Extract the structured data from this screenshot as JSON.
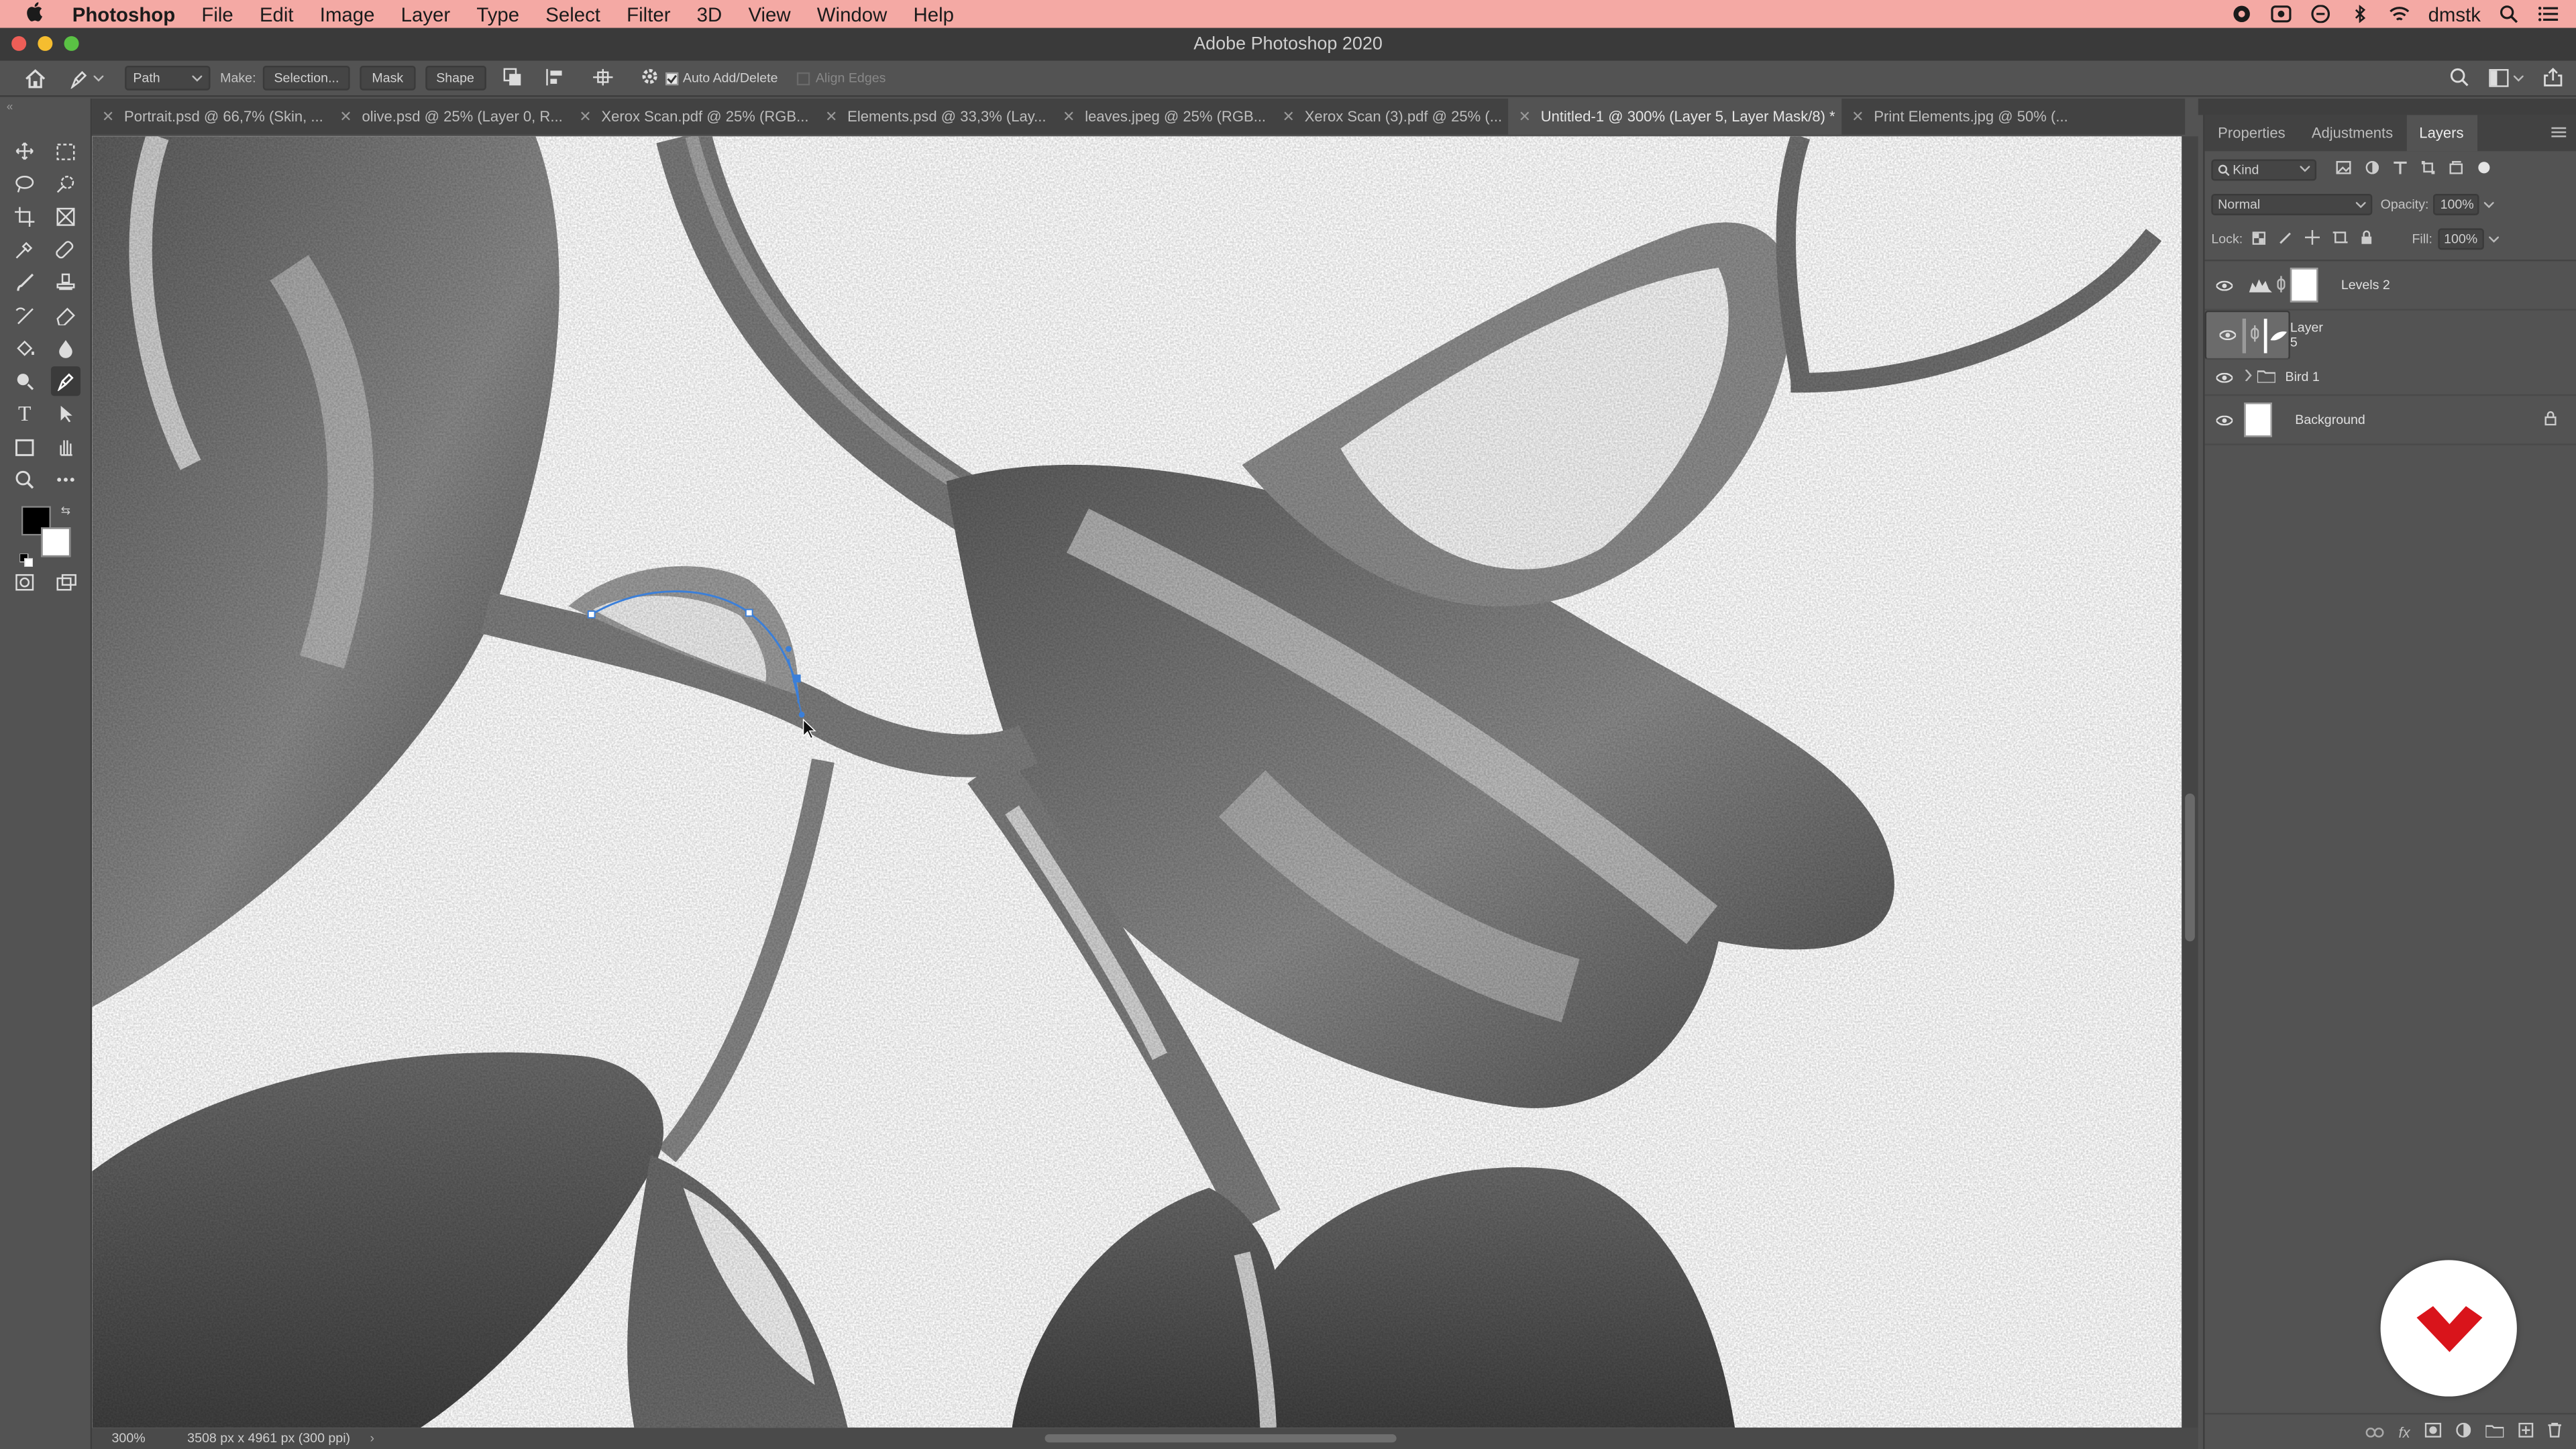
{
  "menubar": {
    "items": [
      "Photoshop",
      "File",
      "Edit",
      "Image",
      "Layer",
      "Type",
      "Select",
      "Filter",
      "3D",
      "View",
      "Window",
      "Help"
    ],
    "user": "dmstk"
  },
  "window": {
    "title": "Adobe Photoshop 2020"
  },
  "options": {
    "mode": "Path",
    "make_label": "Make:",
    "selection_button": "Selection...",
    "mask_button": "Mask",
    "shape_button": "Shape",
    "auto_add_delete": "Auto Add/Delete",
    "align_edges": "Align Edges"
  },
  "tabs": [
    {
      "label": "Portrait.psd @ 66,7% (Skin, ..."
    },
    {
      "label": "olive.psd @ 25% (Layer 0, R..."
    },
    {
      "label": "Xerox Scan.pdf @ 25% (RGB..."
    },
    {
      "label": "Elements.psd @ 33,3% (Lay..."
    },
    {
      "label": "leaves.jpeg @ 25% (RGB..."
    },
    {
      "label": "Xerox Scan (3).pdf @ 25% (..."
    },
    {
      "label": "Untitled-1 @ 300% (Layer 5, Layer Mask/8) *",
      "active": true
    },
    {
      "label": "Print Elements.jpg @ 50% (..."
    }
  ],
  "status": {
    "zoom": "300%",
    "doc_info": "3508 px x 4961 px (300 ppi)"
  },
  "panel": {
    "tabs": [
      "Properties",
      "Adjustments",
      "Layers"
    ],
    "kind_label": "Kind",
    "blend_mode": "Normal",
    "opacity_label": "Opacity:",
    "opacity_value": "100%",
    "lock_label": "Lock:",
    "fill_label": "Fill:",
    "fill_value": "100%",
    "layers": [
      {
        "name": "Levels 2"
      },
      {
        "name": "Layer 5"
      },
      {
        "name": "Bird 1"
      },
      {
        "name": "Background"
      }
    ]
  },
  "colors": {
    "menubar": "#f4a9a4",
    "accent": "#d9141b",
    "path": "#3b7fd9"
  }
}
